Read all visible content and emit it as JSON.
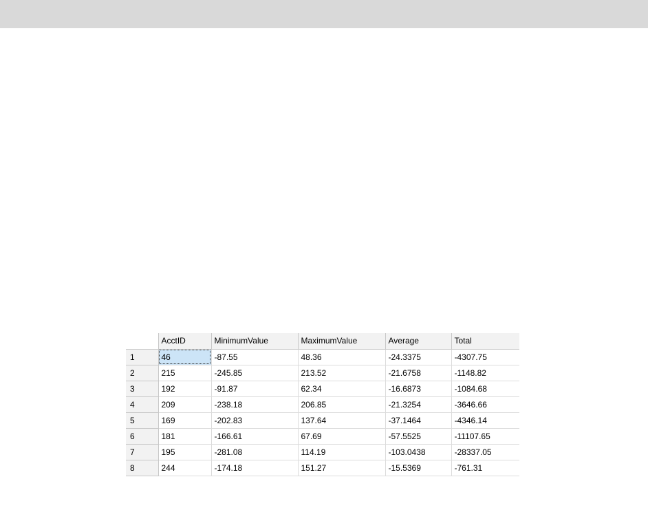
{
  "results_grid": {
    "columns": [
      "",
      "AcctID",
      "MinimumValue",
      "MaximumValue",
      "Average",
      "Total"
    ],
    "rows": [
      [
        "1",
        "46",
        "-87.55",
        "48.36",
        "-24.3375",
        "-4307.75"
      ],
      [
        "2",
        "215",
        "-245.85",
        "213.52",
        "-21.6758",
        "-1148.82"
      ],
      [
        "3",
        "192",
        "-91.87",
        "62.34",
        "-16.6873",
        "-1084.68"
      ],
      [
        "4",
        "209",
        "-238.18",
        "206.85",
        "-21.3254",
        "-3646.66"
      ],
      [
        "5",
        "169",
        "-202.83",
        "137.64",
        "-37.1464",
        "-4346.14"
      ],
      [
        "6",
        "181",
        "-166.61",
        "67.69",
        "-57.5525",
        "-11107.65"
      ],
      [
        "7",
        "195",
        "-281.08",
        "114.19",
        "-103.0438",
        "-28337.05"
      ],
      [
        "8",
        "244",
        "-174.18",
        "151.27",
        "-15.5369",
        "-761.31"
      ]
    ],
    "selected_cell": {
      "row": 1,
      "column": "AcctID"
    },
    "colors": {
      "header_bg": "#f2f2f2",
      "selection_bg": "#cce4f7",
      "top_bar": "#d9d9d9"
    }
  }
}
